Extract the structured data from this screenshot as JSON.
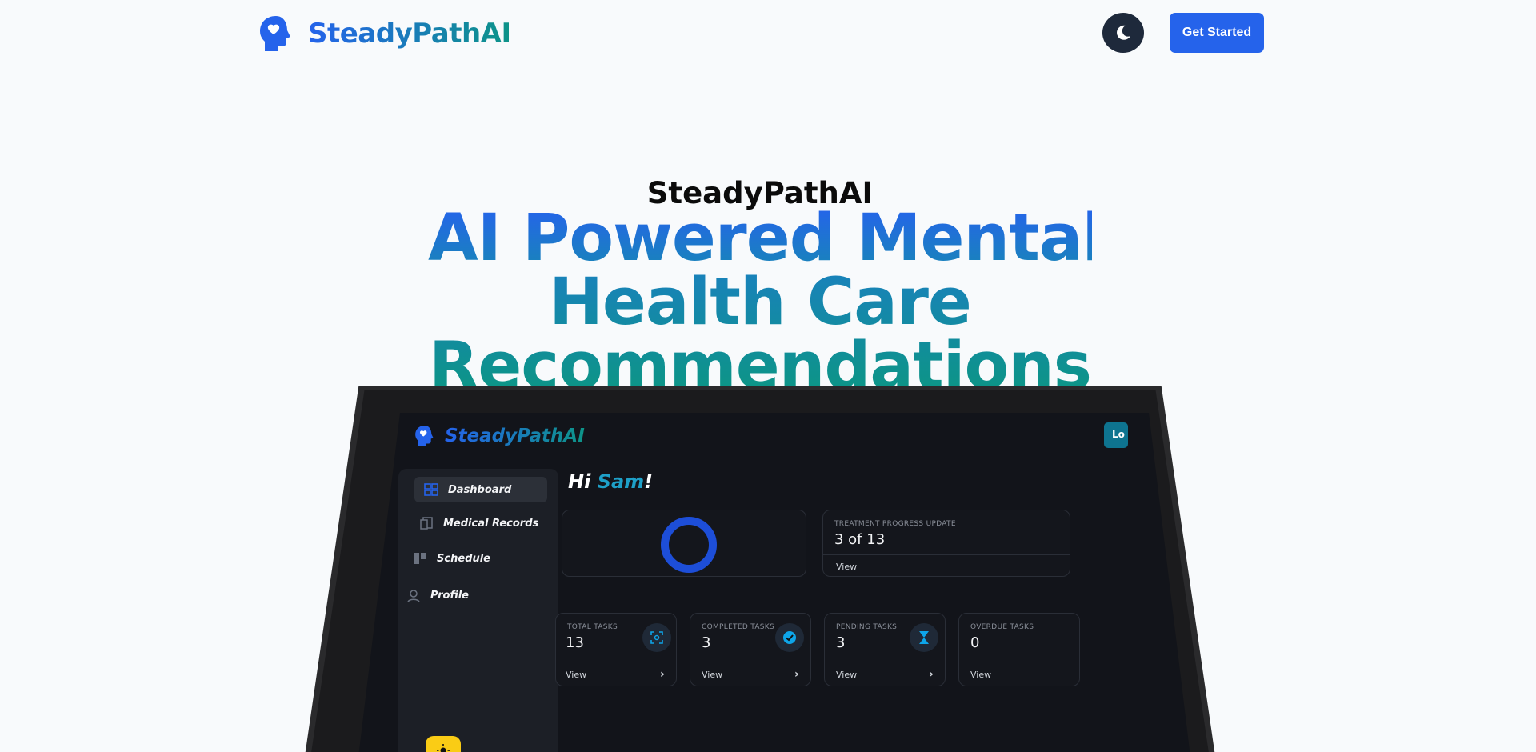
{
  "brand": {
    "name": "SteadyPathAI",
    "icon": "head-heart-icon",
    "color_start": "#2563eb",
    "color_end": "#0d9488"
  },
  "nav": {
    "theme_toggle_icon": "moon-icon",
    "cta_label": "Get Started",
    "cta_color": "#2563eb"
  },
  "hero": {
    "eyebrow": "SteadyPathAI",
    "headline_lines": [
      "AI Powered Mental",
      "Health Care",
      "Recommendations"
    ]
  },
  "dashboard": {
    "brand_name": "SteadyPathAI",
    "corner_tab": "Lo",
    "greeting_prefix": "Hi ",
    "user_name": "Sam",
    "greeting_suffix": "!",
    "sidebar": [
      {
        "label": "Dashboard",
        "icon": "dashboard-icon",
        "active": true
      },
      {
        "label": "Medical Records",
        "icon": "records-icon",
        "active": false
      },
      {
        "label": "Schedule",
        "icon": "schedule-icon",
        "active": false
      },
      {
        "label": "Profile",
        "icon": "profile-icon",
        "active": false
      }
    ],
    "progress": {
      "label": "TREATMENT PROGRESS UPDATE",
      "value": "3 of 13",
      "link": "View"
    },
    "stats": [
      {
        "label": "TOTAL TASKS",
        "value": "13",
        "link": "View",
        "icon": "scan-icon"
      },
      {
        "label": "COMPLETED TASKS",
        "value": "3",
        "link": "View",
        "icon": "check-circle-icon"
      },
      {
        "label": "PENDING TASKS",
        "value": "3",
        "link": "View",
        "icon": "hourglass-icon"
      },
      {
        "label": "OVERDUE TASKS",
        "value": "0",
        "link": "View",
        "icon": "alert-icon"
      }
    ],
    "theme_icon": "sun-icon"
  }
}
